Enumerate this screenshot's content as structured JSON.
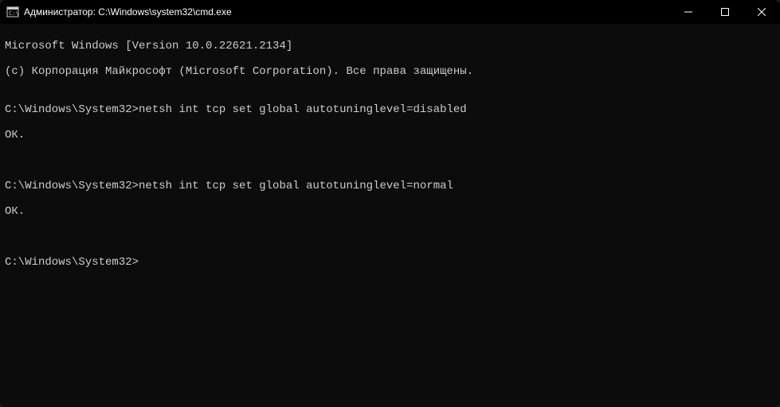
{
  "titlebar": {
    "title": "Администратор: C:\\Windows\\system32\\cmd.exe"
  },
  "terminal": {
    "line1": "Microsoft Windows [Version 10.0.22621.2134]",
    "line2": "(c) Корпорация Майкрософт (Microsoft Corporation). Все права защищены.",
    "blank1": "",
    "prompt1": "C:\\Windows\\System32>",
    "cmd1": "netsh int tcp set global autotuninglevel=disabled",
    "result1": "ОК.",
    "blank2": "",
    "blank3": "",
    "prompt2": "C:\\Windows\\System32>",
    "cmd2": "netsh int tcp set global autotuninglevel=normal",
    "result2": "ОК.",
    "blank4": "",
    "blank5": "",
    "prompt3": "C:\\Windows\\System32>"
  }
}
